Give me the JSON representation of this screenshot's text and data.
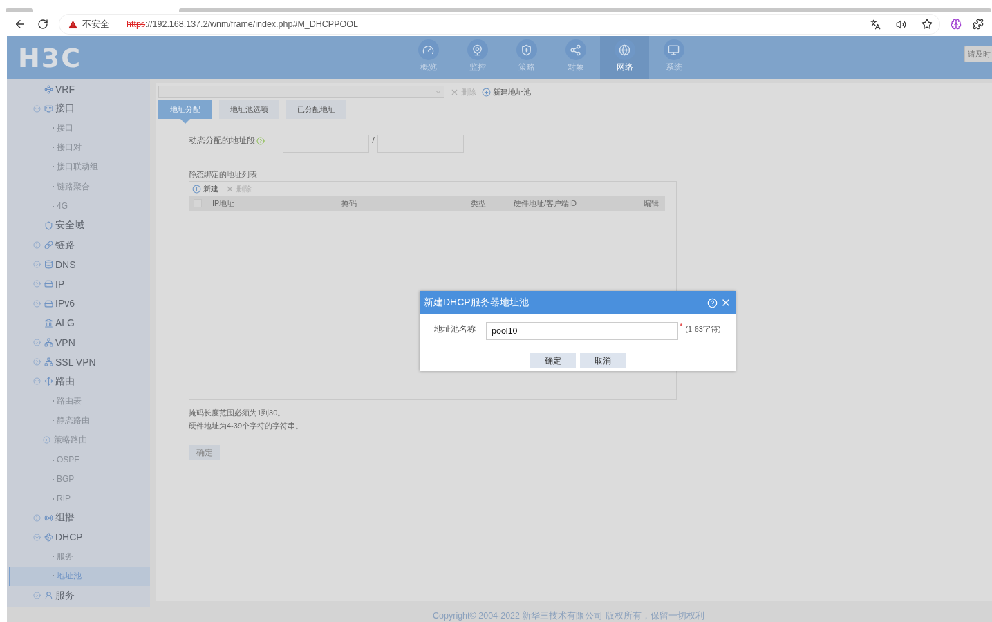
{
  "browser": {
    "security_label": "不安全",
    "url_scheme": "https",
    "url_rest": "://192.168.137.2/wnm/frame/index.php#M_DHCPPOOL"
  },
  "header": {
    "logo": "H3C",
    "nav": [
      {
        "label": "概览",
        "selected": false
      },
      {
        "label": "监控",
        "selected": false
      },
      {
        "label": "策略",
        "selected": false
      },
      {
        "label": "对象",
        "selected": false
      },
      {
        "label": "网络",
        "selected": true
      },
      {
        "label": "系统",
        "selected": false
      }
    ],
    "notice_button": "请及时"
  },
  "sidebar": {
    "items": [
      {
        "label": "VRF",
        "kind": "group",
        "selected": false
      },
      {
        "label": "接口",
        "kind": "group",
        "expanded": true,
        "selected": false,
        "children": [
          {
            "label": "接口",
            "kind": "leaf",
            "selected": false
          },
          {
            "label": "接口对",
            "kind": "leaf",
            "selected": false
          },
          {
            "label": "接口联动组",
            "kind": "leaf",
            "selected": false
          },
          {
            "label": "链路聚合",
            "kind": "leaf",
            "selected": false
          },
          {
            "label": "4G",
            "kind": "leaf",
            "selected": false
          }
        ]
      },
      {
        "label": "安全域",
        "kind": "group",
        "selected": false
      },
      {
        "label": "链路",
        "kind": "group",
        "expanded": false,
        "selected": false
      },
      {
        "label": "DNS",
        "kind": "group",
        "expanded": false,
        "selected": false
      },
      {
        "label": "IP",
        "kind": "group",
        "expanded": false,
        "selected": false
      },
      {
        "label": "IPv6",
        "kind": "group",
        "expanded": false,
        "selected": false
      },
      {
        "label": "ALG",
        "kind": "group",
        "selected": false
      },
      {
        "label": "VPN",
        "kind": "group",
        "expanded": false,
        "selected": false
      },
      {
        "label": "SSL VPN",
        "kind": "group",
        "expanded": false,
        "selected": false
      },
      {
        "label": "路由",
        "kind": "group",
        "expanded": true,
        "selected": false,
        "children": [
          {
            "label": "路由表",
            "kind": "leaf",
            "selected": false
          },
          {
            "label": "静态路由",
            "kind": "leaf",
            "selected": false
          },
          {
            "label": "策略路由",
            "kind": "subgroup",
            "expanded": false,
            "selected": false
          },
          {
            "label": "OSPF",
            "kind": "leaf",
            "selected": false
          },
          {
            "label": "BGP",
            "kind": "leaf",
            "selected": false
          },
          {
            "label": "RIP",
            "kind": "leaf",
            "selected": false
          }
        ]
      },
      {
        "label": "组播",
        "kind": "group",
        "expanded": false,
        "selected": false
      },
      {
        "label": "DHCP",
        "kind": "group",
        "expanded": true,
        "selected": false,
        "children": [
          {
            "label": "服务",
            "kind": "leaf",
            "selected": false
          },
          {
            "label": "地址池",
            "kind": "leaf",
            "selected": true
          }
        ]
      },
      {
        "label": "服务",
        "kind": "group",
        "expanded": false,
        "selected": false
      }
    ]
  },
  "toolbar": {
    "delete_button": {
      "label": "删除",
      "disabled": true
    },
    "new_pool_button": {
      "label": "新建地址池",
      "disabled": false
    }
  },
  "tabs": [
    {
      "label": "地址分配",
      "selected": true
    },
    {
      "label": "地址池选项",
      "selected": false
    },
    {
      "label": "已分配地址",
      "selected": false
    }
  ],
  "dynamic_range": {
    "label": "动态分配的地址段",
    "separator": "/"
  },
  "static_list": {
    "title": "静态绑定的地址列表",
    "new_button": {
      "label": "新建",
      "disabled": false
    },
    "delete_button": {
      "label": "删除",
      "disabled": true
    },
    "select_all_checked": false,
    "columns": [
      "IP地址",
      "掩码",
      "类型",
      "硬件地址/客户端ID",
      "编辑"
    ]
  },
  "notes": [
    "掩码长度范围必须为1到30。",
    "硬件地址为4-39个字符的字符串。"
  ],
  "confirm_button": "确定",
  "dialog": {
    "title": "新建DHCP服务器地址池",
    "field_label": "地址池名称",
    "field_value": "pool10",
    "required_mark": "*",
    "hint": "(1-63字符)",
    "buttons": [
      "确定",
      "取消"
    ]
  },
  "footer": "Copyright© 2004-2022 新华三技术有限公司 版权所有，保留一切权利"
}
